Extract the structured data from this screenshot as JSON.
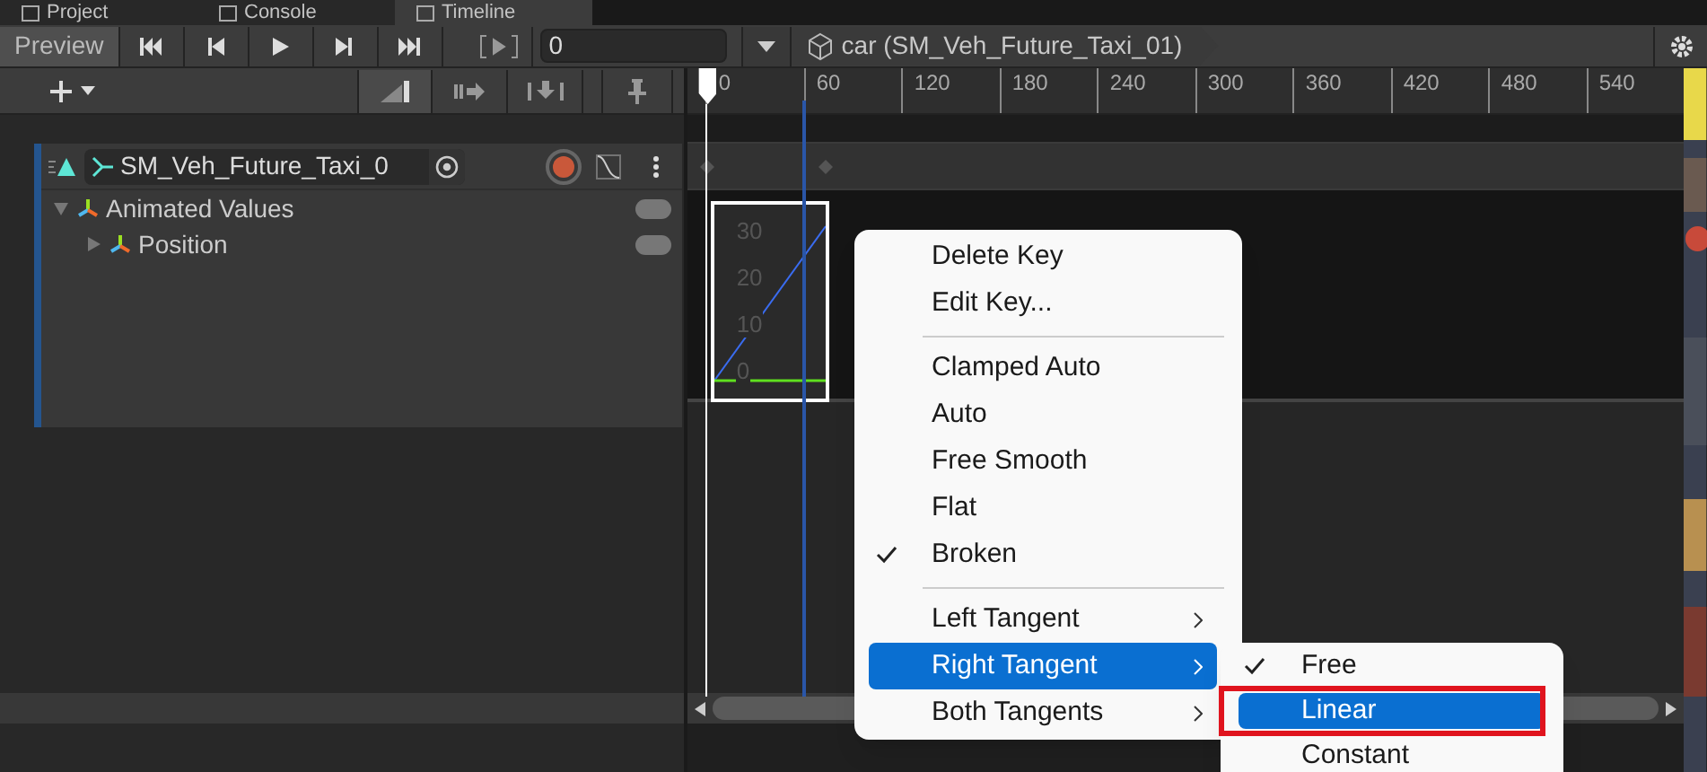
{
  "window_tabs": [
    {
      "label": "Project",
      "selected": false
    },
    {
      "label": "Console",
      "selected": false
    },
    {
      "label": "Timeline",
      "selected": true
    }
  ],
  "toolbar": {
    "preview": {
      "label": "Preview",
      "selected": true
    },
    "frame_field": {
      "value": "0"
    },
    "breadcrumb": "car (SM_Veh_Future_Taxi_01)"
  },
  "ruler": {
    "ticks": [
      "0",
      "60",
      "120",
      "180",
      "240",
      "300",
      "360",
      "420",
      "480",
      "540"
    ]
  },
  "track": {
    "name": "SM_Veh_Future_Taxi_0",
    "recording": true,
    "tree": [
      {
        "label": "Animated Values",
        "expanded": true,
        "key_on": false,
        "children": [
          {
            "label": "Position",
            "expanded": false,
            "key_on": false
          }
        ]
      }
    ]
  },
  "curve_preview": {
    "labels": [
      "30",
      "20",
      "10",
      "0"
    ]
  },
  "context_menu": [
    {
      "kind": "item",
      "label": "Delete Key",
      "checked": false,
      "selected": false
    },
    {
      "kind": "item",
      "label": "Edit Key...",
      "checked": false,
      "selected": false
    },
    {
      "kind": "separator"
    },
    {
      "kind": "item",
      "label": "Clamped Auto",
      "checked": false,
      "selected": false
    },
    {
      "kind": "item",
      "label": "Auto",
      "checked": false,
      "selected": false
    },
    {
      "kind": "item",
      "label": "Free Smooth",
      "checked": false,
      "selected": false
    },
    {
      "kind": "item",
      "label": "Flat",
      "checked": false,
      "selected": false
    },
    {
      "kind": "item",
      "label": "Broken",
      "checked": true,
      "selected": false
    },
    {
      "kind": "separator"
    },
    {
      "kind": "submenu",
      "label": "Left Tangent",
      "checked": false,
      "selected": false
    },
    {
      "kind": "submenu",
      "label": "Right Tangent",
      "checked": false,
      "selected": true
    },
    {
      "kind": "submenu",
      "label": "Both Tangents",
      "checked": false,
      "selected": false
    }
  ],
  "submenu": [
    {
      "label": "Free",
      "checked": true,
      "selected": false,
      "highlighted_frame": false
    },
    {
      "label": "Linear",
      "checked": false,
      "selected": true,
      "highlighted_frame": true
    },
    {
      "label": "Constant",
      "checked": false,
      "selected": false,
      "highlighted_frame": false
    }
  ]
}
